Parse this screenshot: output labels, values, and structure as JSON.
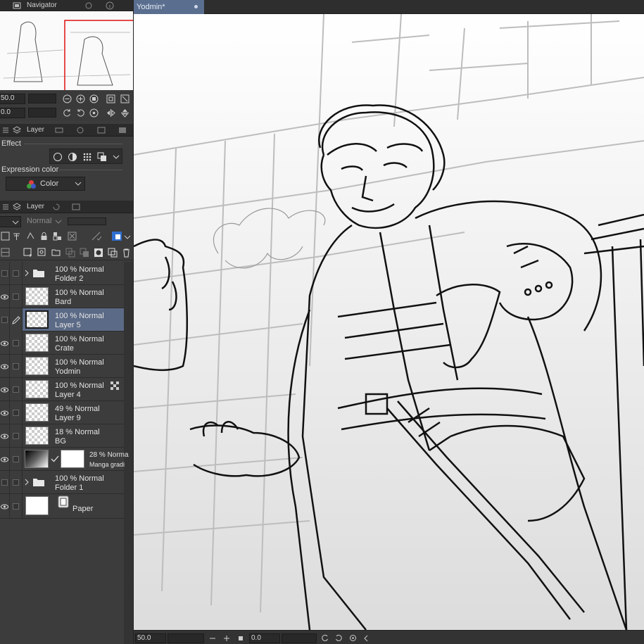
{
  "navigator": {
    "tab_label": "Navigator",
    "zoom_value": "50.0",
    "rotate_value": "0.0"
  },
  "sub_tool_detail": {
    "tab_label": "Layer",
    "effect_label": "Effect",
    "expression_color_label": "Expression color",
    "color_mode_value": "Color"
  },
  "layer_panel": {
    "tab_label": "Layer",
    "blend_mode_value": "Normal",
    "layers": [
      {
        "mode": "100 % Normal",
        "name": "Folder 2",
        "type": "folder",
        "visible": false
      },
      {
        "mode": "100 % Normal",
        "name": "Bard",
        "type": "raster",
        "visible": true
      },
      {
        "mode": "100 % Normal",
        "name": "Layer 5",
        "type": "raster",
        "visible": false,
        "selected": true
      },
      {
        "mode": "100 % Normal",
        "name": "Crate",
        "type": "raster",
        "visible": true
      },
      {
        "mode": "100 % Normal",
        "name": "Yodmin",
        "type": "raster",
        "visible": true
      },
      {
        "mode": "100 % Normal",
        "name": "Layer 4",
        "type": "raster",
        "visible": true
      },
      {
        "mode": "49 % Normal",
        "name": "Layer 9",
        "type": "raster",
        "visible": true
      },
      {
        "mode": "18 % Normal",
        "name": "BG",
        "type": "raster",
        "visible": true
      },
      {
        "mode": "28 % Norma",
        "name": "Manga gradi",
        "type": "gradient",
        "visible": true
      },
      {
        "mode": "100 % Normal",
        "name": "Folder 1",
        "type": "folder",
        "visible": false
      },
      {
        "mode": "",
        "name": "Paper",
        "type": "paper",
        "visible": true
      }
    ]
  },
  "document": {
    "tab_title": "Yodmin*"
  },
  "status_bar": {
    "zoom_value": "50.0",
    "rotation_value": "0.0"
  },
  "colors": {
    "panel_bg": "#3c3c3c",
    "selected_layer": "#5b6a86",
    "doc_tab": "#5a6e8f",
    "navigator_frame": "#e01010"
  }
}
